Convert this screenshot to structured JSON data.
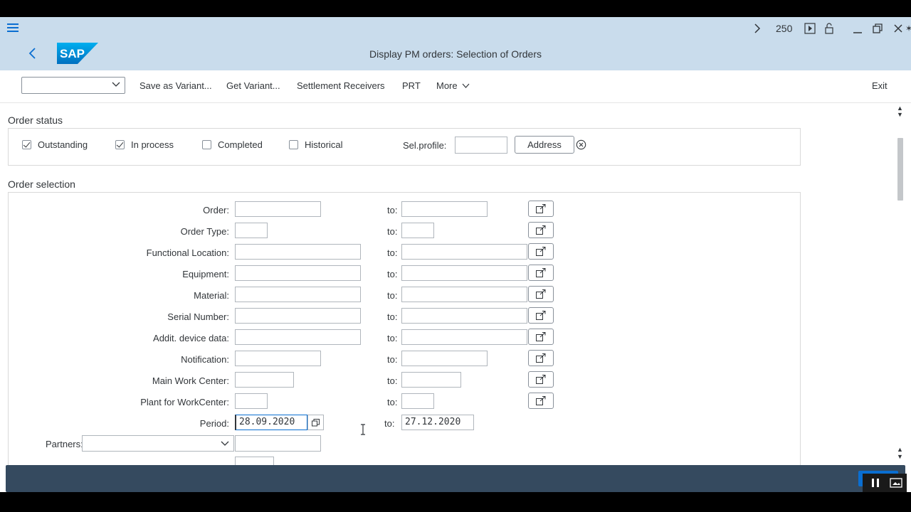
{
  "window": {
    "title": "Display PM orders: Selection of Orders",
    "session_count": "250",
    "brand": "SAP"
  },
  "toolbar": {
    "variant_value": "",
    "save_variant": "Save as Variant...",
    "get_variant": "Get Variant...",
    "settlement": "Settlement Receivers",
    "prt": "PRT",
    "more": "More",
    "exit": "Exit"
  },
  "order_status": {
    "title": "Order status",
    "outstanding": {
      "label": "Outstanding",
      "checked": true
    },
    "in_process": {
      "label": "In process",
      "checked": true
    },
    "completed": {
      "label": "Completed",
      "checked": false
    },
    "historical": {
      "label": "Historical",
      "checked": false
    },
    "sel_profile_label": "Sel.profile:",
    "sel_profile_value": "",
    "address_button": "Address"
  },
  "order_selection": {
    "title": "Order selection",
    "to_label": "to:",
    "rows": [
      {
        "label": "Order:",
        "from": "",
        "to": ""
      },
      {
        "label": "Order Type:",
        "from": "",
        "to": ""
      },
      {
        "label": "Functional Location:",
        "from": "",
        "to": ""
      },
      {
        "label": "Equipment:",
        "from": "",
        "to": ""
      },
      {
        "label": "Material:",
        "from": "",
        "to": ""
      },
      {
        "label": "Serial Number:",
        "from": "",
        "to": ""
      },
      {
        "label": "Addit. device data:",
        "from": "",
        "to": ""
      },
      {
        "label": "Notification:",
        "from": "",
        "to": ""
      },
      {
        "label": "Main Work Center:",
        "from": "",
        "to": ""
      },
      {
        "label": "Plant for WorkCenter:",
        "from": "",
        "to": ""
      },
      {
        "label": "Period:",
        "from": "28.09.2020",
        "to": "27.12.2020"
      }
    ],
    "partners_label": "Partners:",
    "partners_value": "",
    "partners_input": ""
  },
  "icons": {
    "menu": "hamburger-icon",
    "back": "back-arrow-icon",
    "multiple_selection": "multiple-selection-icon",
    "clear": "clear-circle-icon"
  },
  "colors": {
    "shell_header": "#c9dcec",
    "accent": "#0a6ed1",
    "status_bar": "#354a5f"
  }
}
